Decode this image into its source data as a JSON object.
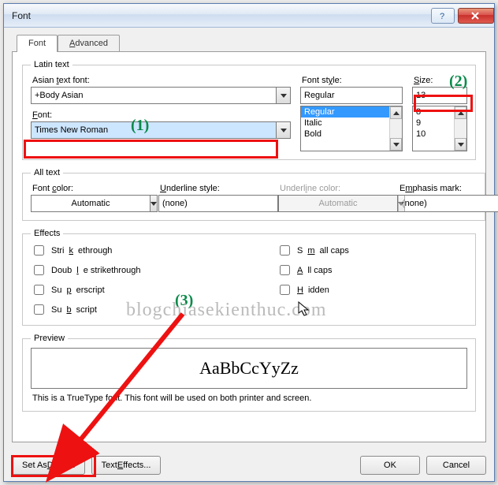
{
  "window": {
    "title": "Font"
  },
  "tabs": {
    "font": "Font",
    "advanced": "Advanced"
  },
  "latin": {
    "legend": "Latin text",
    "asian_label": "Asian text font:",
    "asian_value": "+Body Asian",
    "font_label": "Font:",
    "font_value": "Times New Roman",
    "style_label": "Font style:",
    "style_value": "Regular",
    "style_options": [
      "Regular",
      "Italic",
      "Bold"
    ],
    "size_label": "Size:",
    "size_value": "13",
    "size_options": [
      "8",
      "9",
      "10"
    ]
  },
  "alltext": {
    "legend": "All text",
    "fontcolor_label": "Font color:",
    "fontcolor_value": "Automatic",
    "underline_label": "Underline style:",
    "underline_value": "(none)",
    "ucolor_label": "Underline color:",
    "ucolor_value": "Automatic",
    "emphasis_label": "Emphasis mark:",
    "emphasis_value": "(none)"
  },
  "effects": {
    "legend": "Effects",
    "strike": "Strikethrough",
    "dstrike": "Double strikethrough",
    "superscript": "Superscript",
    "subscript": "Subscript",
    "smallcaps": "Small caps",
    "allcaps": "All caps",
    "hidden": "Hidden"
  },
  "preview": {
    "legend": "Preview",
    "sample": "AaBbCcYyZz",
    "note": "This is a TrueType font. This font will be used on both printer and screen."
  },
  "buttons": {
    "default": "Set As Default",
    "texteffects": "Text Effects...",
    "ok": "OK",
    "cancel": "Cancel"
  },
  "annotations": {
    "n1": "(1)",
    "n2": "(2)",
    "n3": "(3)",
    "watermark": "blogchiasekienthuc.com"
  }
}
